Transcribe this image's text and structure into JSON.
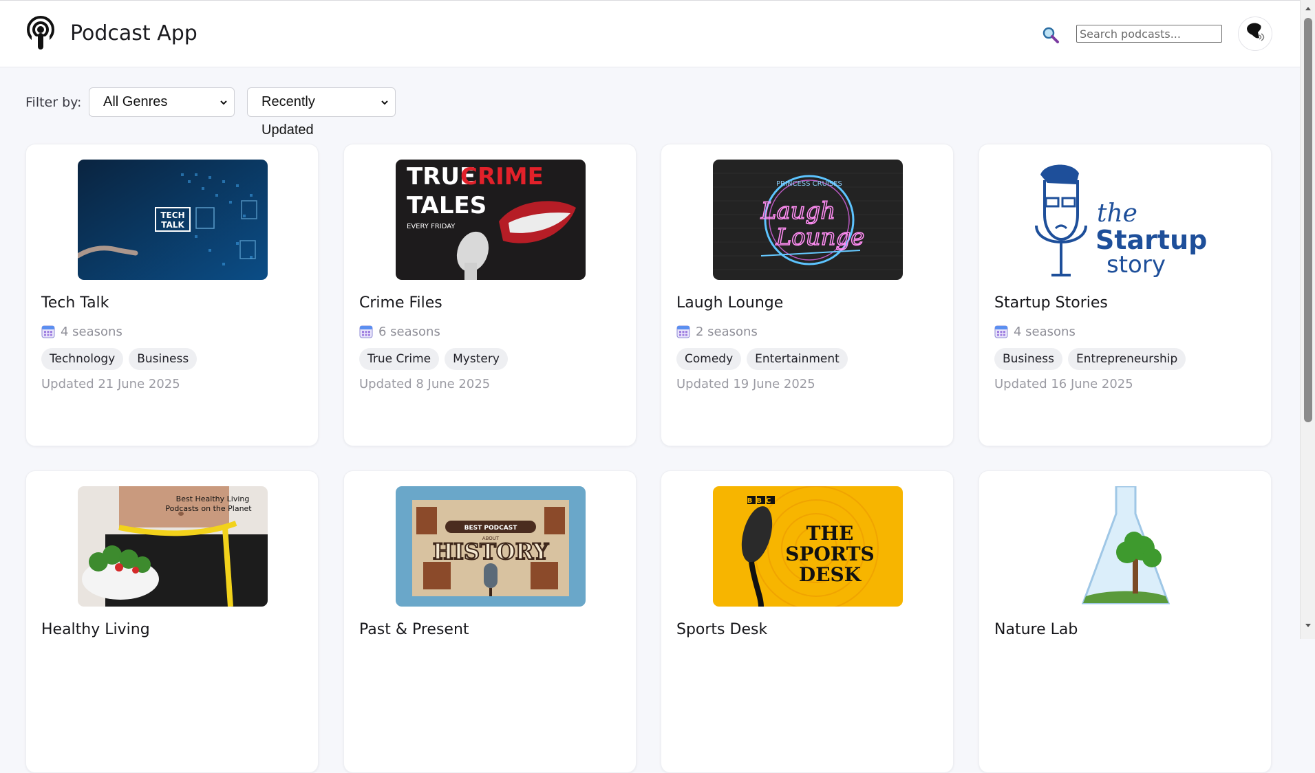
{
  "app": {
    "title": "Podcast App"
  },
  "search": {
    "placeholder": "Search podcasts..."
  },
  "filters": {
    "label": "Filter by:",
    "genre_selected": "All Genres",
    "sort_selected": "Recently Updated"
  },
  "podcasts": [
    {
      "title": "Tech Talk",
      "seasons": "4 seasons",
      "tags": [
        "Technology",
        "Business"
      ],
      "updated": "Updated 21 June 2025",
      "cover_text": [
        "TECH",
        "TALK"
      ]
    },
    {
      "title": "Crime Files",
      "seasons": "6 seasons",
      "tags": [
        "True Crime",
        "Mystery"
      ],
      "updated": "Updated 8 June 2025",
      "cover_text": [
        "TRUE",
        "CRIME",
        "TALES",
        "EVERY FRIDAY"
      ]
    },
    {
      "title": "Laugh Lounge",
      "seasons": "2 seasons",
      "tags": [
        "Comedy",
        "Entertainment"
      ],
      "updated": "Updated 19 June 2025",
      "cover_text": [
        "PRINCESS CRUISES",
        "Laugh",
        "Lounge"
      ]
    },
    {
      "title": "Startup Stories",
      "seasons": "4 seasons",
      "tags": [
        "Business",
        "Entrepreneurship"
      ],
      "updated": "Updated 16 June 2025",
      "cover_text": [
        "the",
        "Startup",
        "story"
      ]
    },
    {
      "title": "Healthy Living",
      "cover_text": [
        "Best Healthy Living",
        "Podcasts on the Planet"
      ]
    },
    {
      "title": "Past & Present",
      "cover_text": [
        "BEST PODCAST",
        "ABOUT",
        "HISTORY"
      ]
    },
    {
      "title": "Sports Desk",
      "cover_text": [
        "BBC",
        "THE",
        "SPORTS",
        "DESK"
      ]
    },
    {
      "title": "Nature Lab"
    }
  ],
  "icons": {
    "logo": "podcast-icon",
    "search": "search-icon",
    "seasons": "calendar-icon",
    "select": "chevron-down-icon"
  },
  "colors": {
    "background": "#f6f7fb",
    "card": "#ffffff",
    "tag_bg": "#eeeff2",
    "muted_text": "#9b9ba3"
  }
}
